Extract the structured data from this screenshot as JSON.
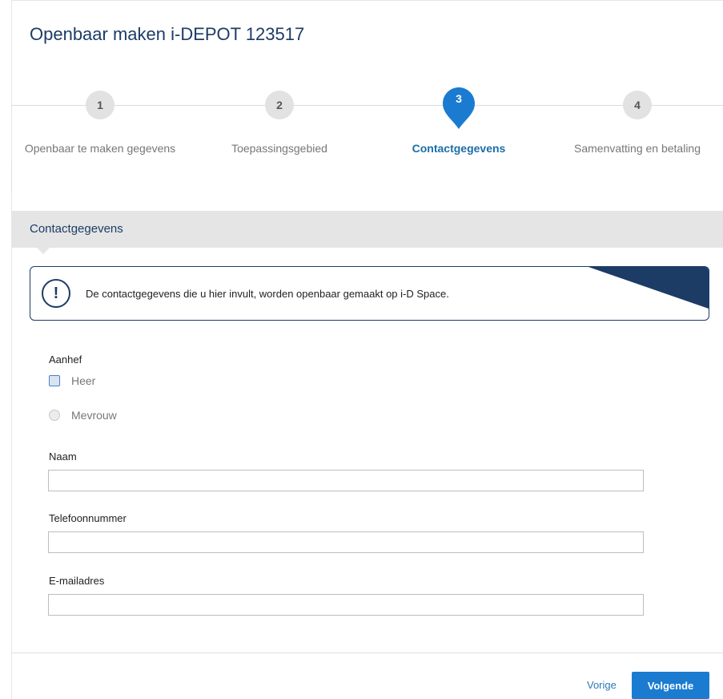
{
  "title": "Openbaar maken i-DEPOT 123517",
  "steps": [
    {
      "number": "1",
      "label": "Openbaar te maken gegevens"
    },
    {
      "number": "2",
      "label": "Toepassingsgebied"
    },
    {
      "number": "3",
      "label": "Contactgegevens"
    },
    {
      "number": "4",
      "label": "Samenvatting en betaling"
    }
  ],
  "active_step": 3,
  "section": {
    "title": "Contactgegevens"
  },
  "info": {
    "icon": "exclamation-icon",
    "text": "De contactgegevens die u hier invult, worden openbaar gemaakt op i-D Space."
  },
  "form": {
    "salutation_label": "Aanhef",
    "options": [
      "Heer",
      "Mevrouw"
    ],
    "name_label": "Naam",
    "name_value": "",
    "phone_label": "Telefoonnummer",
    "phone_value": "",
    "email_label": "E-mailadres",
    "email_value": ""
  },
  "footer": {
    "prev_label": "Vorige",
    "next_label": "Volgende"
  },
  "colors": {
    "brand_dark": "#1c3c66",
    "active_step": "#1b7bd0",
    "button": "#1b7bd0"
  }
}
